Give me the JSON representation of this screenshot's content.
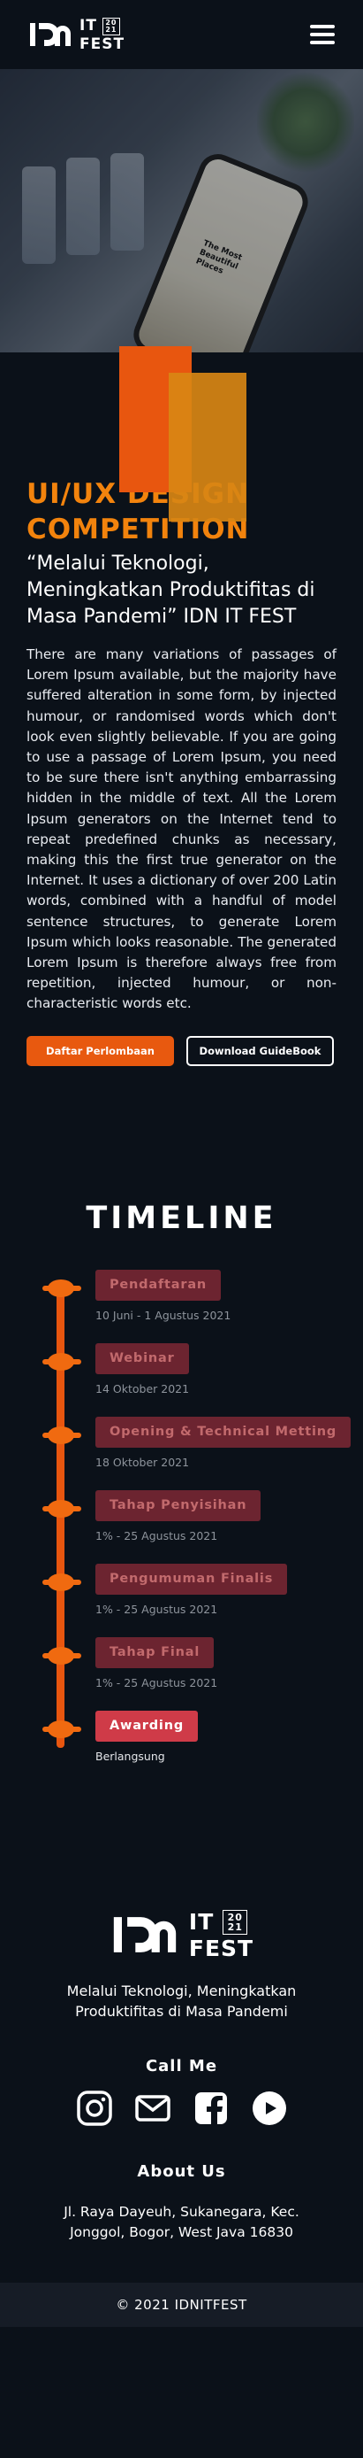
{
  "header": {
    "logo_it": "IT",
    "logo_fest": "FEST",
    "logo_year_top": "20",
    "logo_year_bottom": "21",
    "menu_icon": "hamburger-icon"
  },
  "hero": {
    "phone_text": "The Most Beautiful Places"
  },
  "competition": {
    "title": "UI/UX DESIGN COMPETITION",
    "subtitle": "“Melalui Teknologi, Meningkatkan Produktifitas di Masa Pandemi” IDN IT FEST",
    "description": "There are many variations of passages of Lorem Ipsum available, but the majority have suffered alteration in some form, by injected humour, or randomised words which don't look even slightly believable. If you are going to use a passage of Lorem Ipsum, you need to be sure there isn't anything embarrassing hidden in the middle of text. All the Lorem Ipsum generators on the Internet tend to repeat predefined chunks as necessary, making this the first true generator on the Internet. It uses a dictionary of over 200 Latin words, combined with a handful of model sentence structures, to generate Lorem Ipsum which looks reasonable. The generated Lorem Ipsum is therefore always free from repetition, injected humour, or non-characteristic words etc.",
    "primary_button": "Daftar Perlombaan",
    "secondary_button": "Download GuideBook"
  },
  "timeline": {
    "title": "TIMELINE",
    "items": [
      {
        "label": "Pendaftaran",
        "date": "10 Juni - 1 Agustus 2021"
      },
      {
        "label": "Webinar",
        "date": "14 Oktober 2021"
      },
      {
        "label": "Opening & Technical Metting",
        "date": "18 Oktober 2021"
      },
      {
        "label": "Tahap Penyisihan",
        "date": "1% - 25 Agustus 2021"
      },
      {
        "label": "Pengumuman Finalis",
        "date": "1% - 25 Agustus 2021"
      },
      {
        "label": "Tahap Final",
        "date": "1% - 25 Agustus 2021"
      },
      {
        "label": "Awarding",
        "date": "Berlangsung"
      }
    ]
  },
  "footer": {
    "tagline": "Melalui Teknologi, Meningkatkan Produktifitas di Masa Pandemi",
    "call_me": "Call Me",
    "socials": [
      "instagram-icon",
      "mail-icon",
      "facebook-icon",
      "youtube-icon"
    ],
    "about_us": "About Us",
    "address": "Jl. Raya Dayeuh, Sukanegara, Kec. Jonggol, Bogor, West Java 16830",
    "copyright": "© 2021 IDNITFEST"
  },
  "colors": {
    "accent": "#f2830d",
    "button": "#e8590f",
    "timeline_line": "#e8560f",
    "badge": "#6c2430",
    "badge_active": "#cf3b48",
    "background": "#0b1119"
  }
}
